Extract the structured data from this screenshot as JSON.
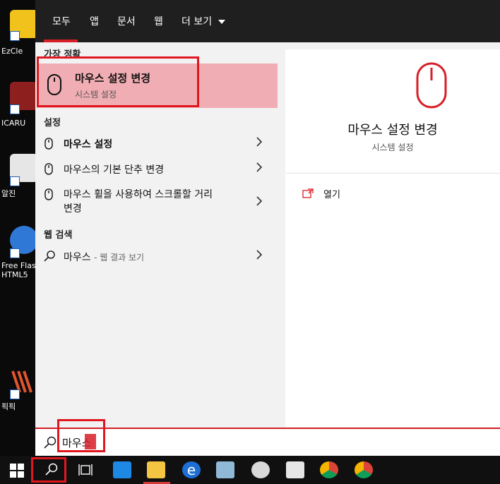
{
  "desktop": {
    "icons": [
      {
        "label": "EzCle",
        "icon": "ezclean-icon",
        "color": "#2d6fd1"
      },
      {
        "label": "ICARU",
        "icon": "icarus-icon",
        "color": "#9e1b1b"
      },
      {
        "label": "알진",
        "icon": "alzip-icon",
        "color": "#d7d7d7"
      },
      {
        "label": "Free Flas\nHTML5",
        "icon": "flash-icon",
        "color": "#2f78d6"
      },
      {
        "label": "픽픽",
        "icon": "picpick-icon",
        "color": "#e0552e"
      }
    ]
  },
  "tabs": [
    "모두",
    "앱",
    "문서",
    "웹",
    "더 보기"
  ],
  "best_match": {
    "section": "가장 정확",
    "title": "마우스 설정 변경",
    "subtitle": "시스템 설정",
    "icon": "mouse-icon"
  },
  "settings": {
    "section": "설정",
    "items": [
      "마우스 설정",
      "마우스의 기본 단추 변경",
      "마우스 휠을 사용하여 스크롤할 거리\n변경"
    ]
  },
  "web": {
    "section": "웹 검색",
    "query": "마우스",
    "suffix": "- 웹 결과 보기"
  },
  "preview": {
    "title": "마우스 설정 변경",
    "subtitle": "시스템 설정",
    "open_label": "열기"
  },
  "search": {
    "query": "마우스"
  },
  "colors": {
    "accent": "#d61f26",
    "highlight": "#f0adb3"
  },
  "taskbar": {
    "icons": [
      "windows-start-icon",
      "search-icon",
      "task-view-icon",
      "calendar-icon",
      "file-explorer-icon",
      "edge-icon",
      "app-icon",
      "app-icon-2",
      "app-icon-3",
      "chrome-icon",
      "chrome-icon-2"
    ]
  }
}
